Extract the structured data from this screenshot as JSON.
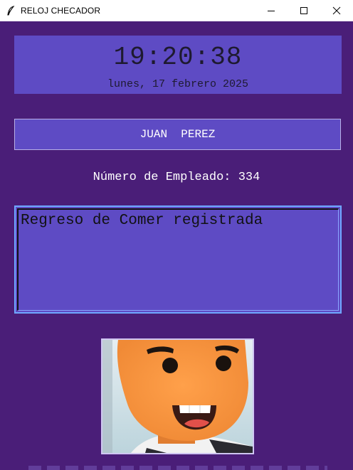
{
  "window": {
    "title": "RELOJ CHECADOR",
    "icon": "feather-icon",
    "controls": [
      "minimize-icon",
      "maximize-icon",
      "close-icon"
    ]
  },
  "clock": {
    "time": "19:20:38",
    "date": "lunes, 17 febrero 2025"
  },
  "employee": {
    "name": "JUAN  PEREZ",
    "number_label": "Número de Empleado: 334"
  },
  "message": {
    "text": "Regreso de Comer registrada"
  },
  "photo": {
    "subject": "cartoon-face-photo"
  },
  "colors": {
    "background": "#4a1e78",
    "panel": "#5e4bc4",
    "message_border": "#6fa8ff"
  }
}
